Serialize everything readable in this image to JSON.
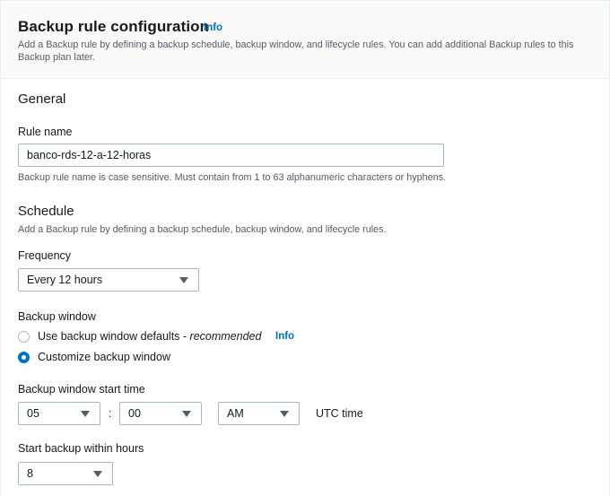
{
  "header": {
    "title": "Backup rule configuration",
    "info": "Info",
    "description": "Add a Backup rule by defining a backup schedule, backup window, and lifecycle rules. You can add additional Backup rules to this Backup plan later."
  },
  "general": {
    "title": "General",
    "rule_name_label": "Rule name",
    "rule_name_value": "banco-rds-12-a-12-horas",
    "rule_name_hint": "Backup rule name is case sensitive. Must contain from 1 to 63 alphanumeric characters or hyphens."
  },
  "schedule": {
    "title": "Schedule",
    "description": "Add a Backup rule by defining a backup schedule, backup window, and lifecycle rules.",
    "frequency_label": "Frequency",
    "frequency_value": "Every 12 hours",
    "backup_window_label": "Backup window",
    "option_defaults": "Use backup window defaults - ",
    "option_defaults_recommended": "recommended",
    "option_defaults_info": "Info",
    "option_customize": "Customize backup window",
    "selected_option": "customize",
    "start_time_label": "Backup window start time",
    "start_hour": "05",
    "time_separator": ":",
    "start_minute": "00",
    "start_ampm": "AM",
    "timezone": "UTC time",
    "start_within_label": "Start backup within hours",
    "start_within_value": "8"
  },
  "colors": {
    "accent": "#0073bb",
    "text": "#16191f",
    "muted": "#545b64",
    "border": "#aab7b8",
    "header_bg": "#fafafa"
  },
  "icons": {
    "dropdown": "caret-down-icon",
    "radio_selected": "radio-checked-icon",
    "radio_unselected": "radio-unchecked-icon"
  }
}
